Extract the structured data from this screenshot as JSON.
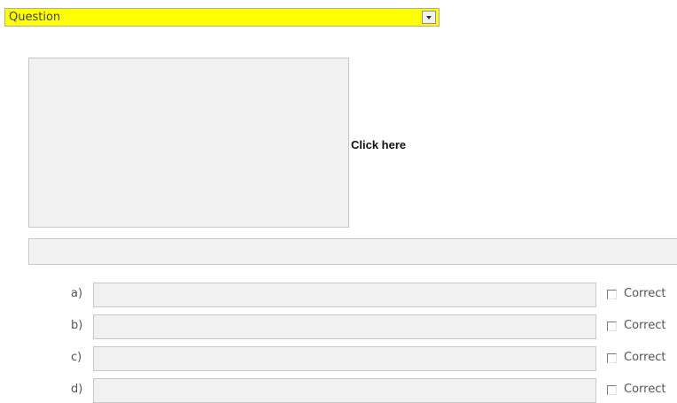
{
  "question_type": {
    "selected": "Question"
  },
  "image_area": {
    "click_label": "Click here"
  },
  "question_text": {
    "value": ""
  },
  "answers": [
    {
      "letter": "a)",
      "value": "",
      "correct_label": "Correct",
      "checked": false
    },
    {
      "letter": "b)",
      "value": "",
      "correct_label": "Correct",
      "checked": false
    },
    {
      "letter": "c)",
      "value": "",
      "correct_label": "Correct",
      "checked": false
    },
    {
      "letter": "d)",
      "value": "",
      "correct_label": "Correct",
      "checked": false
    }
  ],
  "colors": {
    "select_background": "#ffff00",
    "field_background": "#f1f1f1"
  }
}
